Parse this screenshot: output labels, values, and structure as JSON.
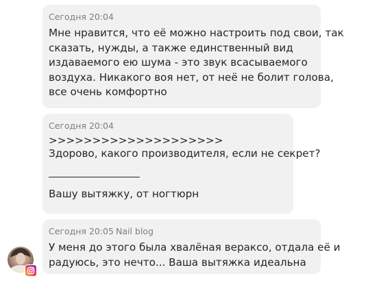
{
  "messages": [
    {
      "time": "Сегодня 20:04",
      "sender": "",
      "lines": [
        "Мне нравится, что её можно настроить под свои, так",
        "сказать, нужды, а также единственный вид",
        "издаваемого ею шума - это звук всасываемого",
        "воздуха. Никакого воя нет, от неё не болит голова,",
        "все очень комфортно"
      ]
    },
    {
      "time": "Сегодня 20:04",
      "sender": "",
      "quote_marker": ">>>>>>>>>>>>>>>>>>>>",
      "quote_text": "Здорово, какого производителя, если не секрет?",
      "reply_text": "Вашу вытяжку, от ногтюрн"
    },
    {
      "time": "Сегодня 20:05",
      "sender": "Nail blog",
      "lines": [
        "У меня до этого была хвалёная вераксо, отдала её и",
        "радуюсь, это нечто... Ваша вытяжка идеальна"
      ]
    }
  ],
  "icons": {
    "avatar": "user-photo",
    "badge": "instagram-icon"
  },
  "colors": {
    "bubble_bg": "#f1f1f2",
    "meta_text": "#7e7e7e",
    "message_text": "#262626"
  }
}
